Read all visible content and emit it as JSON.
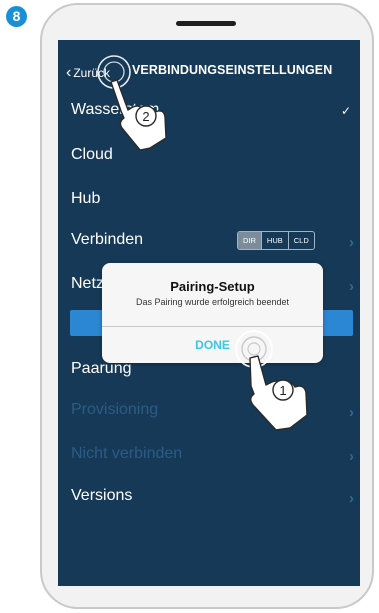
{
  "step_badge": "8",
  "nav": {
    "back_label": "Zurück",
    "title": "VERBINDUNGSEINSTELLUNGEN"
  },
  "rows": {
    "wasserstem": "Wasserstem",
    "cloud": "Cloud",
    "hub": "Hub",
    "verbinden": "Verbinden",
    "netzwerk": "Netzwerk",
    "paarung": "Paarung",
    "provisioning": "Provisioning",
    "nicht_verbinden": "Nicht verbinden",
    "versions": "Versions"
  },
  "segment": [
    "DIR",
    "HUB",
    "CLD"
  ],
  "dialog": {
    "title": "Pairing-Setup",
    "message": "Das Pairing wurde erfolgreich beendet",
    "button": "DONE"
  },
  "callouts": {
    "one": "1",
    "two": "2"
  },
  "colors": {
    "screen_bg": "#163957",
    "accent": "#2b87d3",
    "badge": "#1b8fd6",
    "dialog_button": "#39c6ea"
  },
  "icons": [
    "chevron-left-icon",
    "checkmark-icon",
    "chevron-right-icon",
    "hand-pointer-icon",
    "tap-ripple-icon"
  ]
}
